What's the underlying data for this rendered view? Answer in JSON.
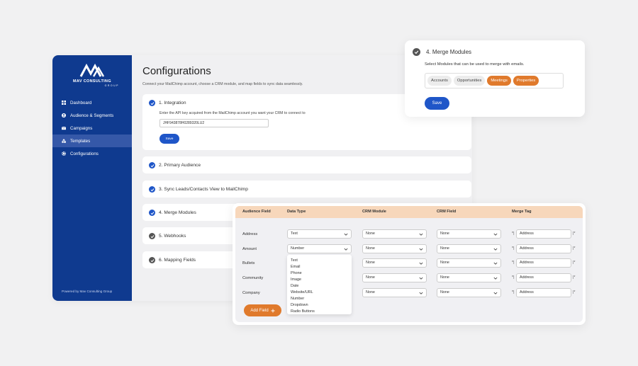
{
  "brand": {
    "name": "MAV CONSULTING",
    "group": "GROUP",
    "colors": {
      "primary": "#0f3a8f",
      "accent": "#1f56c8",
      "orange": "#e07a2c",
      "header": "#f7d7bb"
    }
  },
  "sidebar": {
    "items": [
      {
        "label": "Dashboard",
        "icon": "grid-icon"
      },
      {
        "label": "Audience & Segments",
        "icon": "user-icon"
      },
      {
        "label": "Campaigns",
        "icon": "envelope-icon"
      },
      {
        "label": "Templates",
        "icon": "shapes-icon",
        "active": true
      },
      {
        "label": "Configurations",
        "icon": "gear-icon"
      }
    ],
    "footer": "Powered by Mav Consulting Group"
  },
  "page": {
    "title": "Configurations",
    "subtitle": "Connect your MailChimp account, choose a CRM module, and map fields to sync data seamlessly."
  },
  "integration": {
    "title": "1. Integration",
    "description": "Enter the API key acquired from the MailChimp account you want your CRM to connect to",
    "api_key": "JHF943878H0289320LU2",
    "save_label": "Save"
  },
  "sections": [
    {
      "title": "2. Primary Audience"
    },
    {
      "title": "3. Sync Leads/Contacts View to MailChimp"
    },
    {
      "title": "4. Merge Modules"
    },
    {
      "title": "5. Webhooks"
    },
    {
      "title": "6. Mapping Fields"
    }
  ],
  "merge_popup": {
    "title": "4. Merge Modules",
    "description": "Select Modules that can be used to merge with emails.",
    "modules": [
      {
        "label": "Accounts",
        "selected": false
      },
      {
        "label": "Opportunities",
        "selected": false
      },
      {
        "label": "Meetings",
        "selected": true
      },
      {
        "label": "Properties",
        "selected": true
      }
    ],
    "save_label": "Save"
  },
  "mapping": {
    "headers": [
      "Audience Field",
      "Data Type",
      "CRM Module",
      "CRM Field",
      "Merge Tag"
    ],
    "rows": [
      {
        "field": "Address",
        "type": "Text",
        "module": "None",
        "crm_field": "None",
        "tag": "Address"
      },
      {
        "field": "Amount",
        "type": "Number",
        "module": "None",
        "crm_field": "None",
        "tag": "Address"
      },
      {
        "field": "Bullets",
        "type": "",
        "module": "None",
        "crm_field": "None",
        "tag": "Address"
      },
      {
        "field": "Community",
        "type": "",
        "module": "None",
        "crm_field": "None",
        "tag": "Address"
      },
      {
        "field": "Company",
        "type": "",
        "module": "None",
        "crm_field": "None",
        "tag": "Address"
      }
    ],
    "tag_prefix": "*|",
    "tag_suffix": "|*",
    "type_options": [
      "Text",
      "Email",
      "Phone",
      "Image",
      "Date",
      "Website/URL",
      "Number",
      "Dropdown",
      "Radio Buttons"
    ],
    "add_label": "Add Field",
    "add_icon": "plus-icon"
  }
}
